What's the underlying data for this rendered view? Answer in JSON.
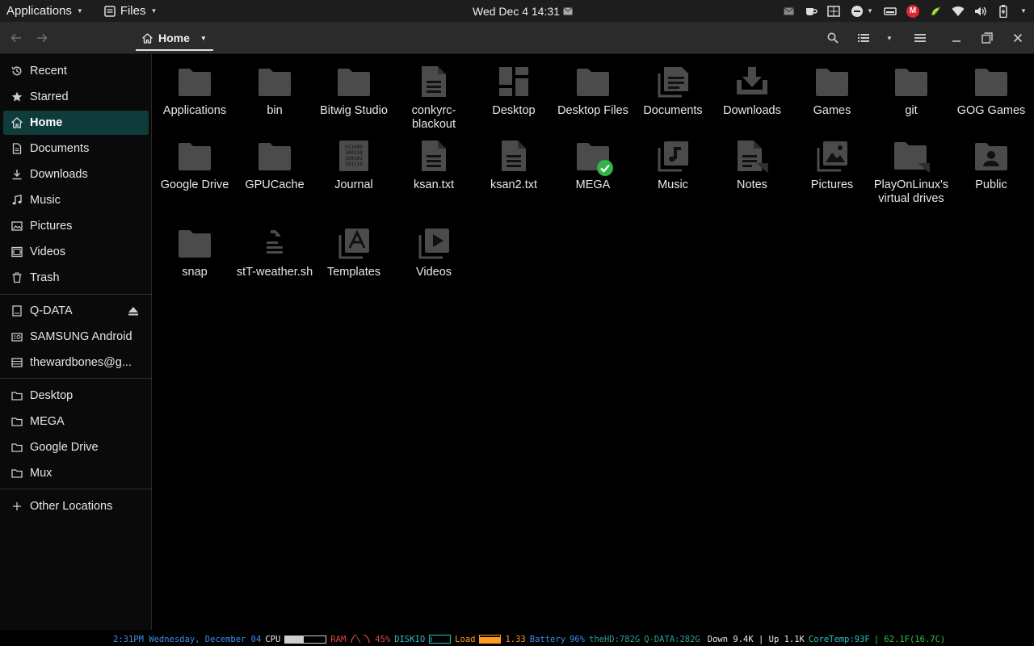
{
  "top_panel": {
    "applications_label": "Applications",
    "files_label": "Files",
    "clock": "Wed Dec 4  14:31",
    "mega_letter": "M"
  },
  "headerbar": {
    "path_label": "Home"
  },
  "sidebar": {
    "places": [
      {
        "label": "Recent",
        "icon": "clock-icon"
      },
      {
        "label": "Starred",
        "icon": "star-icon"
      },
      {
        "label": "Home",
        "icon": "home-icon",
        "active": true
      },
      {
        "label": "Documents",
        "icon": "document-icon"
      },
      {
        "label": "Downloads",
        "icon": "download-icon"
      },
      {
        "label": "Music",
        "icon": "music-icon"
      },
      {
        "label": "Pictures",
        "icon": "picture-icon"
      },
      {
        "label": "Videos",
        "icon": "video-icon"
      },
      {
        "label": "Trash",
        "icon": "trash-icon"
      }
    ],
    "devices": [
      {
        "label": "Q-DATA",
        "icon": "drive-icon"
      },
      {
        "label": "SAMSUNG Android",
        "icon": "phone-icon"
      },
      {
        "label": "thewardbones@g...",
        "icon": "network-drive-icon"
      }
    ],
    "bookmarks": [
      {
        "label": "Desktop",
        "icon": "folder-icon"
      },
      {
        "label": "MEGA",
        "icon": "folder-icon"
      },
      {
        "label": "Google Drive",
        "icon": "folder-icon"
      },
      {
        "label": "Mux",
        "icon": "folder-icon"
      }
    ],
    "other_locations": "Other Locations"
  },
  "files": [
    {
      "label": "Applications",
      "icon": "folder-icon"
    },
    {
      "label": "bin",
      "icon": "folder-icon"
    },
    {
      "label": "Bitwig Studio",
      "icon": "folder-icon"
    },
    {
      "label": "conkyrc-blackout",
      "icon": "text-file-icon"
    },
    {
      "label": "Desktop",
      "icon": "desktop-folder-icon"
    },
    {
      "label": "Desktop Files",
      "icon": "folder-icon"
    },
    {
      "label": "Documents",
      "icon": "documents-folder-icon"
    },
    {
      "label": "Downloads",
      "icon": "downloads-folder-icon"
    },
    {
      "label": "Games",
      "icon": "folder-icon"
    },
    {
      "label": "git",
      "icon": "folder-icon"
    },
    {
      "label": "GOG Games",
      "icon": "folder-icon"
    },
    {
      "label": "Google Drive",
      "icon": "folder-icon"
    },
    {
      "label": "GPUCache",
      "icon": "folder-icon"
    },
    {
      "label": "Journal",
      "icon": "binary-file-icon",
      "binary_lines": [
        "011000",
        "100110",
        "100101",
        "101110"
      ]
    },
    {
      "label": "ksan.txt",
      "icon": "text-file-icon"
    },
    {
      "label": "ksan2.txt",
      "icon": "text-file-icon"
    },
    {
      "label": "MEGA",
      "icon": "synced-folder-icon"
    },
    {
      "label": "Music",
      "icon": "music-folder-icon"
    },
    {
      "label": "Notes",
      "icon": "link-file-icon"
    },
    {
      "label": "Pictures",
      "icon": "pictures-folder-icon"
    },
    {
      "label": "PlayOnLinux's virtual drives",
      "icon": "link-folder-icon"
    },
    {
      "label": "Public",
      "icon": "public-folder-icon"
    },
    {
      "label": "snap",
      "icon": "folder-icon"
    },
    {
      "label": "stT-weather.sh",
      "icon": "script-file-icon"
    },
    {
      "label": "Templates",
      "icon": "templates-folder-icon"
    },
    {
      "label": "Videos",
      "icon": "videos-folder-icon"
    }
  ],
  "conky": {
    "datetime": "2:31PM Wednesday, December 04",
    "cpu_label": "CPU",
    "cpu_fraction": 0.45,
    "ram_label": "RAM",
    "ram_value": "45%",
    "diskio_label": "DISKIO",
    "load_label": "Load",
    "load_value": "1.33",
    "battery_label": "Battery",
    "battery_value": "96%",
    "thehd": "theHD:782G",
    "qdata": "Q-DATA:282G",
    "net": "Down 9.4K | Up 1.1K",
    "coretemp": "CoreTemp:93F",
    "temp_extra": "| 62.1F(16.7C)"
  }
}
